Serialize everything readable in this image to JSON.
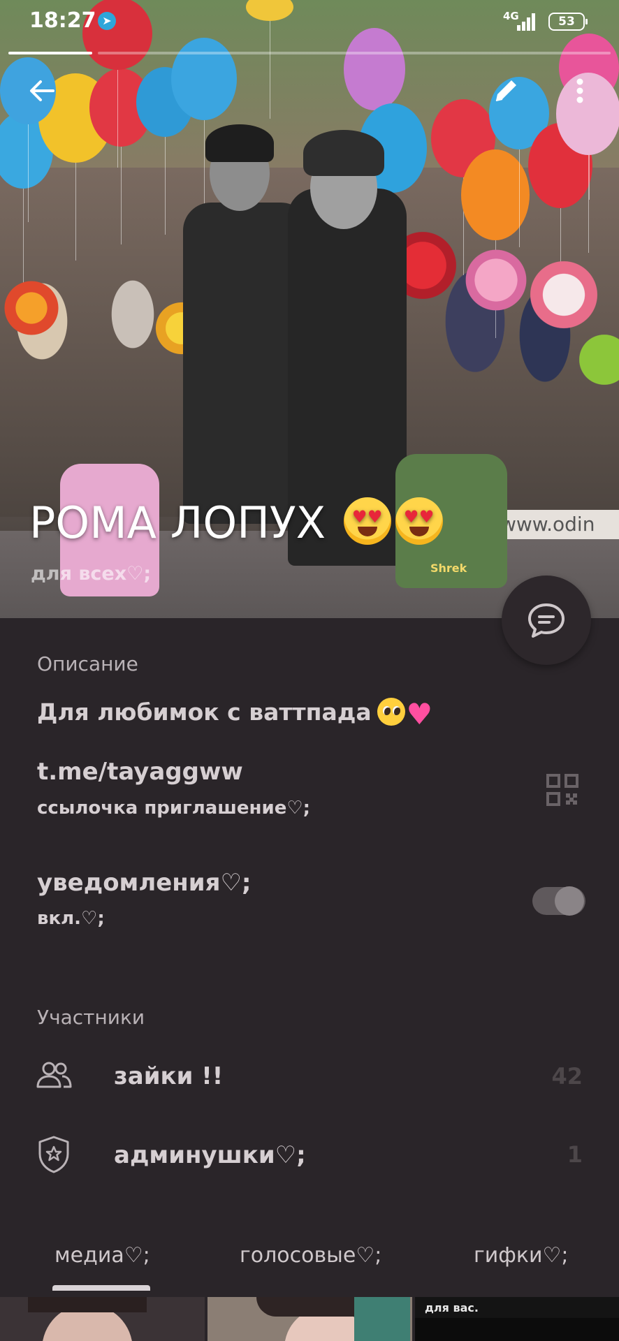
{
  "status_bar": {
    "time": "18:27",
    "network": "4G",
    "battery": "53"
  },
  "chat": {
    "title": "РОМА ЛОПУХ",
    "subtitle": "для всех♡;"
  },
  "info": {
    "description_label": "Описание",
    "description_text": "Для любимок с ваттпада",
    "link": "t.me/tayaggww",
    "link_caption": "ссылочка приглашение♡;",
    "notifications_label": "уведомления♡;",
    "notifications_state": "вкл.♡;",
    "notifications_on": true
  },
  "members": {
    "label": "Участники",
    "rows": [
      {
        "label": "зайки !!",
        "count": "42",
        "icon": "people-icon"
      },
      {
        "label": "админушки♡;",
        "count": "1",
        "icon": "shield-star-icon"
      }
    ]
  },
  "tabs": [
    {
      "label": "медиа♡;",
      "active": true
    },
    {
      "label": "голосовые♡;",
      "active": false
    },
    {
      "label": "гифки♡;",
      "active": false
    }
  ],
  "media_thumb_text": "для вас.",
  "hero_banner": "www.odin",
  "backpack_label": "Shrek",
  "colors": {
    "background": "#2a2529",
    "text": "#d6cfd2",
    "muted": "#b9b2b6"
  }
}
